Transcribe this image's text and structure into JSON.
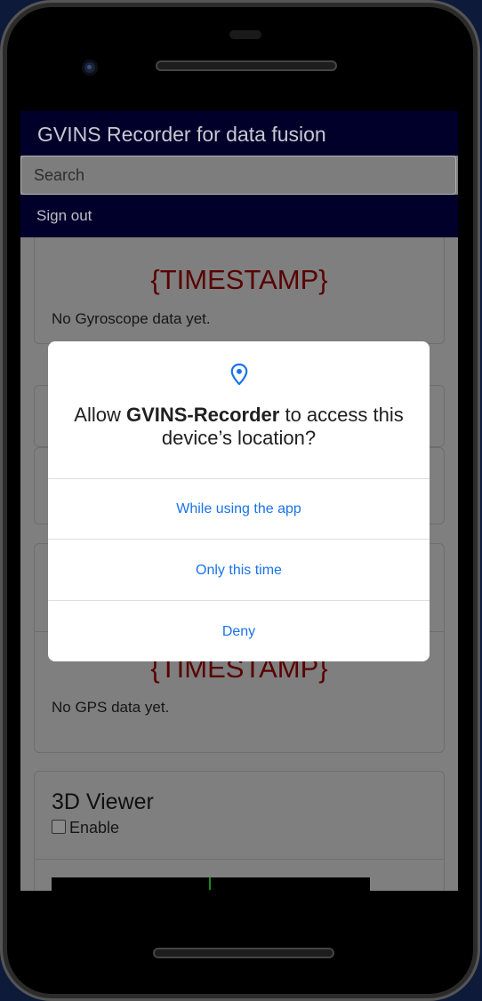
{
  "app": {
    "title": "GVINS Recorder for data fusion",
    "search_placeholder": "Search",
    "sign_out": "Sign out"
  },
  "cards": {
    "gyroscope": {
      "timestamp": "{TIMESTAMP}",
      "status": "No Gyroscope data yet."
    },
    "gps": {
      "timestamp": "{TIMESTAMP}",
      "status": "No GPS data yet."
    },
    "viewer": {
      "title": "3D Viewer",
      "enable_label": "Enable"
    }
  },
  "permission_dialog": {
    "prefix": "Allow ",
    "app_name": "GVINS-Recorder",
    "suffix": " to access this device’s location?",
    "buttons": {
      "while_using": "While using the app",
      "only_this_time": "Only this time",
      "deny": "Deny"
    }
  },
  "colors": {
    "appbar": "#00002b",
    "accent": "#1a73e8",
    "timestamp": "#590000"
  },
  "icons": {
    "dialog_icon": "location-pin-icon"
  }
}
